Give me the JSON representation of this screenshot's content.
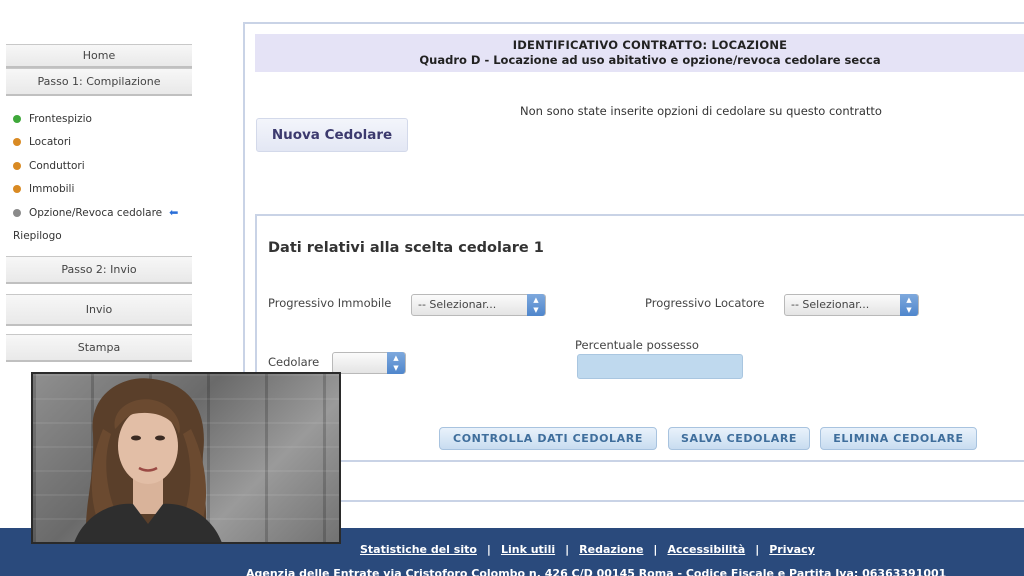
{
  "sidebar": {
    "home": "Home",
    "step1": "Passo 1: Compilazione",
    "items": [
      {
        "label": "Frontespizio",
        "status": "green"
      },
      {
        "label": "Locatori",
        "status": "orange"
      },
      {
        "label": "Conduttori",
        "status": "orange"
      },
      {
        "label": "Immobili",
        "status": "orange"
      },
      {
        "label": "Opzione/Revoca cedolare",
        "status": "gray",
        "current_marker": "arrow-left-icon"
      }
    ],
    "recap": "Riepilogo",
    "step2": "Passo 2: Invio",
    "send": "Invio",
    "print": "Stampa"
  },
  "header": {
    "title": "IDENTIFICATIVO CONTRATTO: LOCAZIONE",
    "subtitle": "Quadro D - Locazione ad uso abitativo e opzione/revoca cedolare secca"
  },
  "main": {
    "no_options_text": "Non sono state inserite opzioni di cedolare su questo contratto",
    "new_button": "Nuova Cedolare"
  },
  "form": {
    "section_title": "Dati relativi alla scelta cedolare 1",
    "progressivo_immobile_label": "Progressivo Immobile",
    "progressivo_immobile_value": "-- Selezionar...",
    "progressivo_locatore_label": "Progressivo Locatore",
    "progressivo_locatore_value": "-- Selezionar...",
    "cedolare_label": "Cedolare",
    "cedolare_value": "",
    "percentuale_label": "Percentuale possesso",
    "percentuale_value": "",
    "buttons": {
      "check": "CONTROLLA DATI CEDOLARE",
      "save": "SALVA CEDOLARE",
      "delete": "ELIMINA CEDOLARE"
    }
  },
  "footer": {
    "links": [
      "Statistiche del sito",
      "Link utili",
      "Redazione",
      "Accessibilità",
      "Privacy"
    ],
    "address": "Agenzia delle Entrate via Cristoforo Colombo n. 426 C/D 00145 Roma - Codice Fiscale e Partita Iva: 06363391001"
  },
  "colors": {
    "footer_bg": "#2a4a7c",
    "header_bg": "#e5e3f6",
    "button_text": "#3f6e9c",
    "status_green": "#3fa83a",
    "status_orange": "#d98a23",
    "status_gray": "#8a8a8a"
  }
}
